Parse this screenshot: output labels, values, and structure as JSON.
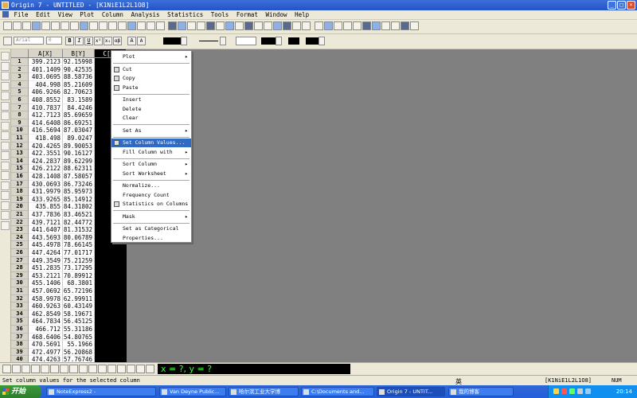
{
  "window": {
    "title": "Origin 7 - UNTITLED - [K1NiE1L2L1O8]",
    "buttons": [
      "_",
      "□",
      "×"
    ]
  },
  "menubar": [
    "File",
    "Edit",
    "View",
    "Plot",
    "Column",
    "Analysis",
    "Statistics",
    "Tools",
    "Format",
    "Window",
    "Help"
  ],
  "format_toolbar": {
    "font": "Arial",
    "size": "0",
    "styles": [
      "B",
      "I",
      "U",
      "x²",
      "x₂",
      "αβ",
      "A",
      "A"
    ]
  },
  "worksheet": {
    "columns": [
      "A[X]",
      "B[Y]",
      "C[Y]"
    ],
    "selected_column": "C[Y]",
    "rows": [
      {
        "n": "1",
        "a": "399.2123",
        "b": "92.15998"
      },
      {
        "n": "2",
        "a": "401.1409",
        "b": "90.42535"
      },
      {
        "n": "3",
        "a": "403.0695",
        "b": "88.58736"
      },
      {
        "n": "4",
        "a": "404.998",
        "b": "85.21609"
      },
      {
        "n": "5",
        "a": "406.9266",
        "b": "82.70623"
      },
      {
        "n": "6",
        "a": "408.8552",
        "b": "83.1589"
      },
      {
        "n": "7",
        "a": "410.7837",
        "b": "84.4246"
      },
      {
        "n": "8",
        "a": "412.7123",
        "b": "85.69659"
      },
      {
        "n": "9",
        "a": "414.6408",
        "b": "86.69251"
      },
      {
        "n": "10",
        "a": "416.5694",
        "b": "87.03047"
      },
      {
        "n": "11",
        "a": "418.498",
        "b": "89.0247"
      },
      {
        "n": "12",
        "a": "420.4265",
        "b": "89.90053"
      },
      {
        "n": "13",
        "a": "422.3551",
        "b": "90.16127"
      },
      {
        "n": "14",
        "a": "424.2837",
        "b": "89.62299"
      },
      {
        "n": "15",
        "a": "426.2122",
        "b": "88.62311"
      },
      {
        "n": "16",
        "a": "428.1408",
        "b": "87.58057"
      },
      {
        "n": "17",
        "a": "430.0693",
        "b": "86.73246"
      },
      {
        "n": "18",
        "a": "431.9979",
        "b": "85.95973"
      },
      {
        "n": "19",
        "a": "433.9265",
        "b": "85.14912"
      },
      {
        "n": "20",
        "a": "435.855",
        "b": "84.31802"
      },
      {
        "n": "21",
        "a": "437.7836",
        "b": "83.46521"
      },
      {
        "n": "22",
        "a": "439.7121",
        "b": "82.44772"
      },
      {
        "n": "23",
        "a": "441.6407",
        "b": "81.31532"
      },
      {
        "n": "24",
        "a": "443.5693",
        "b": "80.06789"
      },
      {
        "n": "25",
        "a": "445.4978",
        "b": "78.66145"
      },
      {
        "n": "26",
        "a": "447.4264",
        "b": "77.01717"
      },
      {
        "n": "27",
        "a": "449.3549",
        "b": "75.21259"
      },
      {
        "n": "28",
        "a": "451.2835",
        "b": "73.17295"
      },
      {
        "n": "29",
        "a": "453.2121",
        "b": "70.89912"
      },
      {
        "n": "30",
        "a": "455.1406",
        "b": "68.3801"
      },
      {
        "n": "31",
        "a": "457.0692",
        "b": "65.72196"
      },
      {
        "n": "32",
        "a": "458.9978",
        "b": "62.99911"
      },
      {
        "n": "33",
        "a": "460.9263",
        "b": "60.43149"
      },
      {
        "n": "34",
        "a": "462.8549",
        "b": "58.19671"
      },
      {
        "n": "35",
        "a": "464.7834",
        "b": "56.45125"
      },
      {
        "n": "36",
        "a": "466.712",
        "b": "55.31186"
      },
      {
        "n": "37",
        "a": "468.6406",
        "b": "54.80765"
      },
      {
        "n": "38",
        "a": "470.5691",
        "b": "55.1966"
      },
      {
        "n": "39",
        "a": "472.4977",
        "b": "56.20868"
      },
      {
        "n": "40",
        "a": "474.4263",
        "b": "57.76746"
      }
    ]
  },
  "context_menu": {
    "highlighted": "Set Column Values...",
    "items": [
      {
        "label": "Plot",
        "submenu": true
      },
      {
        "sep": true
      },
      {
        "label": "Cut",
        "icon": "cut-icon"
      },
      {
        "label": "Copy",
        "icon": "copy-icon"
      },
      {
        "label": "Paste",
        "icon": "paste-icon"
      },
      {
        "sep": true
      },
      {
        "label": "Insert"
      },
      {
        "label": "Delete"
      },
      {
        "label": "Clear"
      },
      {
        "sep": true
      },
      {
        "label": "Set As",
        "submenu": true
      },
      {
        "sep": true
      },
      {
        "label": "Set Column Values...",
        "icon": "set-values-icon"
      },
      {
        "label": "Fill Column with",
        "submenu": true
      },
      {
        "sep": true
      },
      {
        "label": "Sort Column",
        "submenu": true
      },
      {
        "label": "Sort Worksheet",
        "submenu": true
      },
      {
        "sep": true
      },
      {
        "label": "Normalize..."
      },
      {
        "label": "Frequency Count"
      },
      {
        "label": "Statistics on Columns",
        "icon": "stats-icon"
      },
      {
        "sep": true
      },
      {
        "label": "Mask",
        "submenu": true
      },
      {
        "sep": true
      },
      {
        "label": "Set as Categorical"
      },
      {
        "label": "Properties..."
      }
    ]
  },
  "coord_display": "x = ?, y = ?",
  "status": {
    "message": "Set column values for the selected column",
    "ime": "英",
    "window_name": "[K1NiE1L2L1O8]",
    "mode": "NUM"
  },
  "taskbar": {
    "start": "开始",
    "tasks": [
      {
        "label": "NoteExpress2 -"
      },
      {
        "label": "Van Deyne Public..."
      },
      {
        "label": "哈尔滨工业大学博"
      },
      {
        "label": "C:\\Documents and..."
      },
      {
        "label": "Origin 7 - UNTIT...",
        "active": true
      },
      {
        "label": "我的博客"
      }
    ],
    "clock": "20:14"
  }
}
